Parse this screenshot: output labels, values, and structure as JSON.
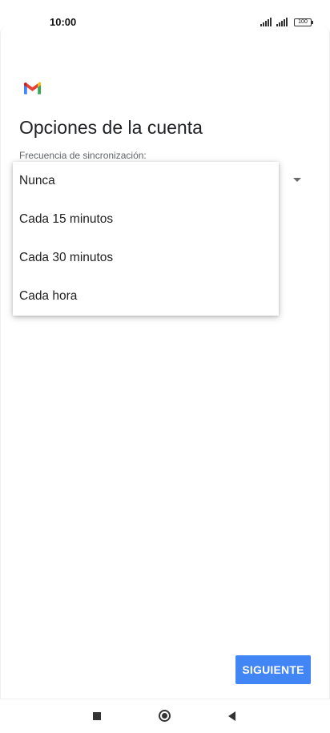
{
  "status_bar": {
    "time": "10:00",
    "battery": "100",
    "icons": [
      "signal-icon",
      "signal-icon",
      "battery-icon"
    ]
  },
  "app": {
    "logo": "gmail-logo",
    "title": "Opciones de la cuenta"
  },
  "sync_field": {
    "label": "Frecuencia de sincronización:",
    "options": [
      "Nunca",
      "Cada 15 minutos",
      "Cada 30 minutos",
      "Cada hora"
    ]
  },
  "actions": {
    "next_label": "SIGUIENTE"
  },
  "colors": {
    "accent": "#4285f4",
    "gmail_red": "#ea4335",
    "gmail_blue": "#4285f4",
    "gmail_green": "#34a853",
    "gmail_yellow": "#fbbc04"
  },
  "nav_bar": {
    "icons": [
      "recent-apps-icon",
      "home-icon",
      "back-icon"
    ]
  }
}
